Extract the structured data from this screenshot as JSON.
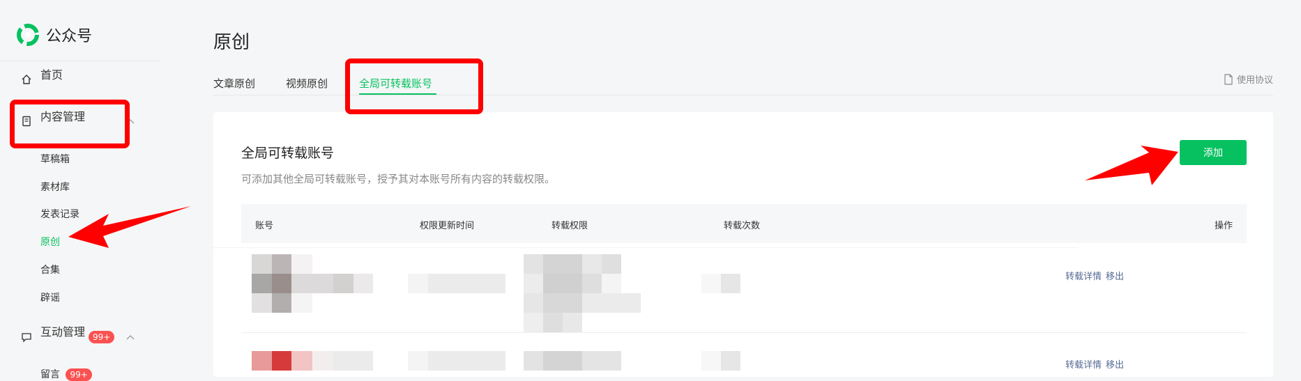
{
  "app": {
    "name": "公众号"
  },
  "sidebar": {
    "home": "首页",
    "content_mgmt": "内容管理",
    "content_items": [
      "草稿箱",
      "素材库",
      "发表记录",
      "原创",
      "合集",
      "辟谣"
    ],
    "interact_mgmt": "互动管理",
    "interact_badge": "99+",
    "interact_items": [
      {
        "label": "留言",
        "badge": "99+"
      }
    ]
  },
  "page": {
    "title": "原创",
    "tabs": [
      "文章原创",
      "视频原创",
      "全局可转载账号"
    ],
    "agreement": "使用协议"
  },
  "panel": {
    "title": "全局可转载账号",
    "description": "可添加其他全局可转载账号，授予其对本账号所有内容的转载权限。",
    "add_label": "添加"
  },
  "table": {
    "columns": [
      "账号",
      "权限更新时间",
      "转载权限",
      "转载次数",
      "操作"
    ],
    "rows": [
      {
        "actions": [
          "转载详情",
          "移出"
        ]
      },
      {
        "actions": [
          "转载详情",
          "移出"
        ]
      }
    ]
  },
  "colors": {
    "accent": "#07c160",
    "link": "#576b95",
    "annotation": "#ff0000",
    "badge": "#fa5151"
  }
}
